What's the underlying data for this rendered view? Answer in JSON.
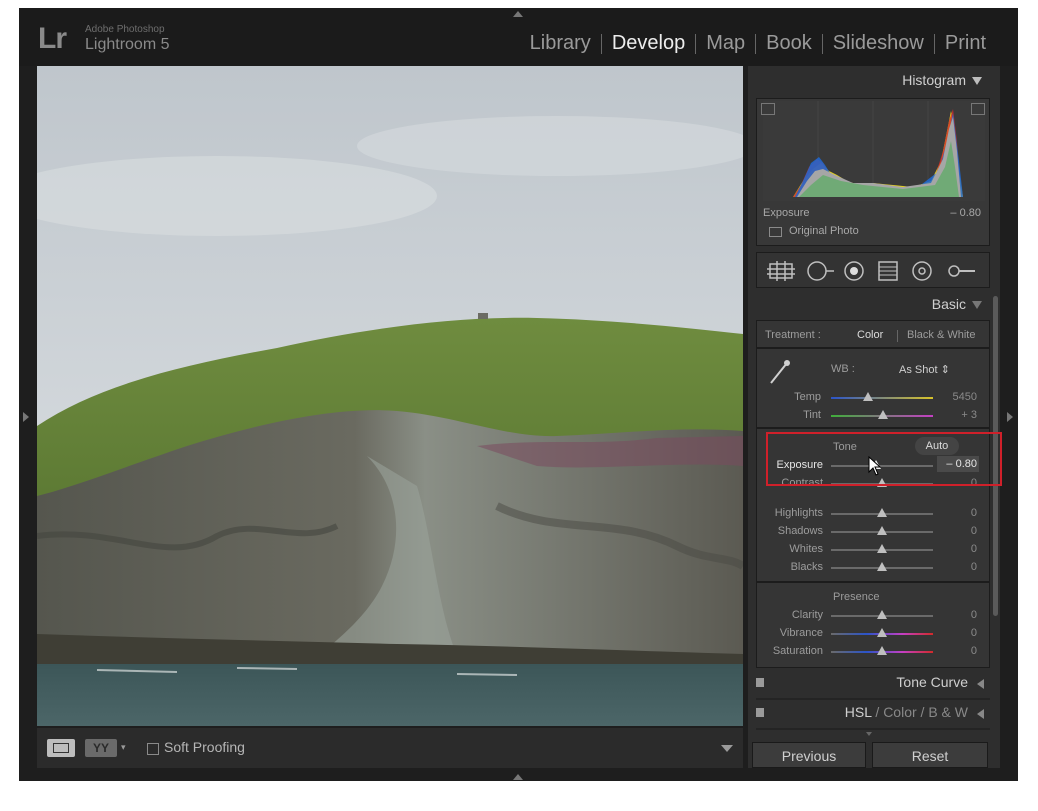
{
  "app": {
    "logo_mark": "Lr",
    "logo_vendor": "Adobe Photoshop",
    "logo_product": "Lightroom 5"
  },
  "modules": [
    "Library",
    "Develop",
    "Map",
    "Book",
    "Slideshow",
    "Print"
  ],
  "active_module": "Develop",
  "toolbar": {
    "yy_label": "YY",
    "soft_proofing_label": "Soft Proofing",
    "soft_proofing_checked": false
  },
  "histogram": {
    "title": "Histogram",
    "exposure_label": "Exposure",
    "exposure_value": "– 0.80",
    "original_photo_label": "Original Photo"
  },
  "basic": {
    "title": "Basic",
    "treatment_label": "Treatment :",
    "treatment_color": "Color",
    "treatment_bw": "Black & White",
    "wb_label": "WB :",
    "wb_value": "As Shot",
    "temp_label": "Temp",
    "temp_value": "5450",
    "tint_label": "Tint",
    "tint_value": "+ 3",
    "tone_label": "Tone",
    "auto_label": "Auto",
    "exposure_label": "Exposure",
    "exposure_value": "– 0.80",
    "contrast_label": "Contrast",
    "contrast_value": "0",
    "highlights_label": "Highlights",
    "highlights_value": "0",
    "shadows_label": "Shadows",
    "shadows_value": "0",
    "whites_label": "Whites",
    "whites_value": "0",
    "blacks_label": "Blacks",
    "blacks_value": "0",
    "presence_label": "Presence",
    "clarity_label": "Clarity",
    "clarity_value": "0",
    "vibrance_label": "Vibrance",
    "vibrance_value": "0",
    "saturation_label": "Saturation",
    "saturation_value": "0"
  },
  "panels": {
    "tone_curve": "Tone Curve",
    "hsl": "HSL",
    "color": "Color",
    "bw": "B & W"
  },
  "buttons": {
    "previous": "Previous",
    "reset": "Reset"
  },
  "colors": {
    "highlight_box": "#d0202a",
    "active_module": "#ededed"
  }
}
